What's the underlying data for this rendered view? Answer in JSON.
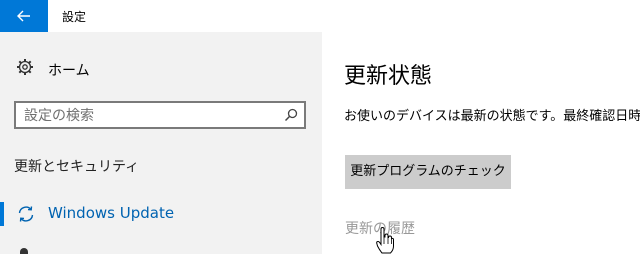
{
  "window": {
    "title": "設定"
  },
  "sidebar": {
    "home_label": "ホーム",
    "search_placeholder": "設定の検索",
    "section_heading": "更新とセキュリティ",
    "items": [
      {
        "label": "Windows Update",
        "icon": "sync-icon",
        "selected": true
      }
    ]
  },
  "main": {
    "title": "更新状態",
    "status": "お使いのデバイスは最新の状態です。最終確認日時",
    "check_button": "更新プログラムのチェック",
    "history_link": "更新の履歴"
  },
  "colors": {
    "accent": "#0078d7",
    "sidebar_bg": "#f2f2f2",
    "button_bg": "#cccccc",
    "link_gray": "#999999"
  }
}
